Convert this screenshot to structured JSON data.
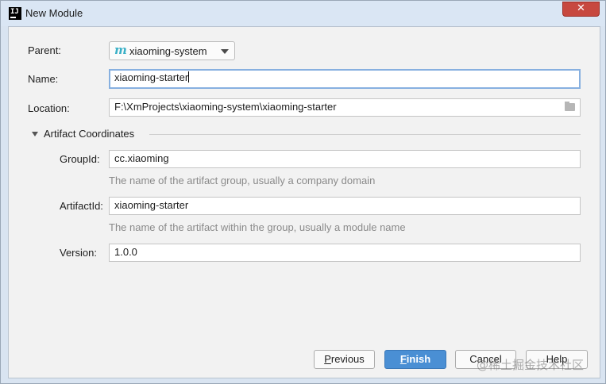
{
  "window": {
    "title": "New Module",
    "app_icon_text": "IJ",
    "close_glyph": "✕"
  },
  "form": {
    "parent": {
      "label": "Parent:",
      "value": "xiaoming-system",
      "icon": "m"
    },
    "name": {
      "label": "Name:",
      "value": "xiaoming-starter"
    },
    "location": {
      "label": "Location:",
      "value": "F:\\XmProjects\\xiaoming-system\\xiaoming-starter"
    },
    "section_title": "Artifact Coordinates",
    "group_id": {
      "label": "GroupId:",
      "value": "cc.xiaoming",
      "hint": "The name of the artifact group, usually a company domain"
    },
    "artifact_id": {
      "label": "ArtifactId:",
      "value": "xiaoming-starter",
      "hint": "The name of the artifact within the group, usually a module name"
    },
    "version": {
      "label": "Version:",
      "value": "1.0.0"
    }
  },
  "buttons": {
    "previous_mnemonic": "P",
    "previous_rest": "revious",
    "finish_mnemonic": "F",
    "finish_rest": "inish",
    "cancel_label": "Cancel",
    "help_label": "Help"
  },
  "watermark": "@稀土掘金技术社区"
}
